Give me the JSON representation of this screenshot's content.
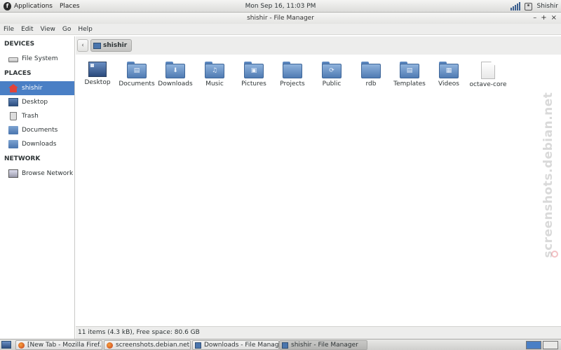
{
  "top_panel": {
    "applications_label": "Applications",
    "places_label": "Places",
    "clock": "Mon Sep 16, 11:03 PM",
    "user": "Shishir"
  },
  "window": {
    "title": "shishir - File Manager",
    "controls": {
      "minimize": "–",
      "maximize": "+",
      "close": "×"
    }
  },
  "menubar": {
    "items": [
      "File",
      "Edit",
      "View",
      "Go",
      "Help"
    ]
  },
  "sidebar": {
    "devices_header": "DEVICES",
    "devices": [
      {
        "label": "File System",
        "icon": "drive-icon"
      }
    ],
    "places_header": "PLACES",
    "places": [
      {
        "label": "shishir",
        "icon": "home-icon",
        "selected": true
      },
      {
        "label": "Desktop",
        "icon": "desktop-icon"
      },
      {
        "label": "Trash",
        "icon": "trash-icon"
      },
      {
        "label": "Documents",
        "icon": "folder-icon"
      },
      {
        "label": "Downloads",
        "icon": "folder-icon"
      }
    ],
    "network_header": "NETWORK",
    "network": [
      {
        "label": "Browse Network",
        "icon": "network-icon"
      }
    ]
  },
  "location": {
    "back": "‹",
    "crumb": "shishir"
  },
  "files": [
    {
      "name": "Desktop",
      "kind": "desktop"
    },
    {
      "name": "Documents",
      "kind": "folder",
      "emblem": "▤"
    },
    {
      "name": "Downloads",
      "kind": "folder",
      "emblem": "⬇"
    },
    {
      "name": "Music",
      "kind": "folder",
      "emblem": "♫"
    },
    {
      "name": "Pictures",
      "kind": "folder",
      "emblem": "▣"
    },
    {
      "name": "Projects",
      "kind": "folder",
      "emblem": ""
    },
    {
      "name": "Public",
      "kind": "folder",
      "emblem": "⟳"
    },
    {
      "name": "rdb",
      "kind": "folder",
      "emblem": ""
    },
    {
      "name": "Templates",
      "kind": "folder",
      "emblem": "▤"
    },
    {
      "name": "Videos",
      "kind": "folder",
      "emblem": "▦"
    },
    {
      "name": "octave-core",
      "kind": "document"
    }
  ],
  "statusbar": {
    "text": "11 items (4.3 kB), Free space: 80.6 GB"
  },
  "watermark": "screenshots.debian.net",
  "taskbar": {
    "tasks": [
      {
        "label": "[New Tab - Mozilla Firef...",
        "icon": "firefox-icon"
      },
      {
        "label": "screenshots.debian.net ...",
        "icon": "firefox-icon"
      },
      {
        "label": "Downloads - File Manager",
        "icon": "file-manager-icon"
      },
      {
        "label": "shishir - File Manager",
        "icon": "file-manager-icon",
        "active": true
      }
    ]
  },
  "colors": {
    "selection": "#4a7fc5",
    "folder": "#6f97cc",
    "panel": "#e4e4e2"
  }
}
